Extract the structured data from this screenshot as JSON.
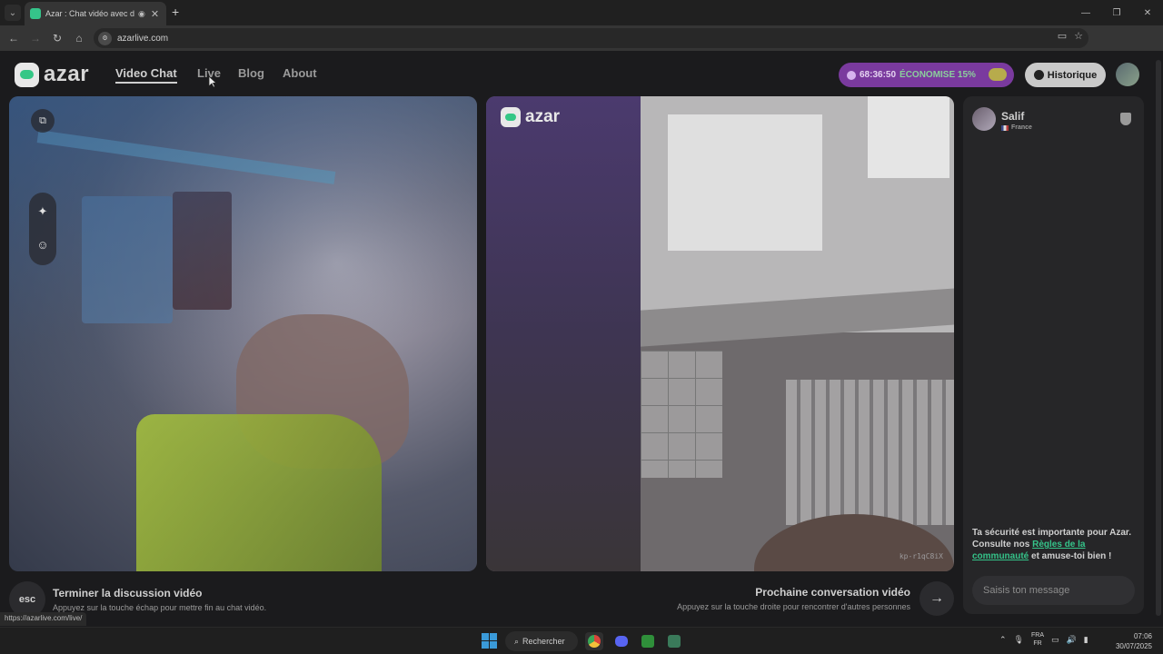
{
  "browser": {
    "tab_title": "Azar : Chat vidéo avec de n",
    "url": "azarlive.com",
    "status_url": "https://azarlive.com/live/"
  },
  "nav": {
    "logo": "azar",
    "links": [
      "Video Chat",
      "Live",
      "Blog",
      "About"
    ],
    "active": "Video Chat"
  },
  "promo": {
    "timer": "68:36:50",
    "text": "ÉCONOMISE 15%"
  },
  "history_label": "Historique",
  "remote_video": {
    "logo": "azar",
    "id": "kp-r1qC8iX"
  },
  "actions": {
    "end": {
      "key": "esc",
      "title": "Terminer la discussion vidéo",
      "subtitle": "Appuyez sur la touche échap pour mettre fin au chat vidéo."
    },
    "next": {
      "title": "Prochaine conversation vidéo",
      "subtitle": "Appuyez sur la touche droite pour rencontrer d'autres personnes"
    }
  },
  "chat": {
    "partner_name": "Salif",
    "partner_country": "France",
    "safety_text_1": "Ta sécurité est importante pour Azar. Consulte nos ",
    "safety_link": "Règles de la communauté",
    "safety_text_2": " et amuse-toi bien !",
    "input_placeholder": "Saisis ton message"
  },
  "taskbar": {
    "search_label": "Rechercher",
    "lang_top": "FRA",
    "lang_bottom": "FR",
    "time": "07:06",
    "date": "30/07/2025"
  },
  "colors": {
    "accent_green": "#35c48a",
    "promo_purple": "#7a3a9e"
  }
}
